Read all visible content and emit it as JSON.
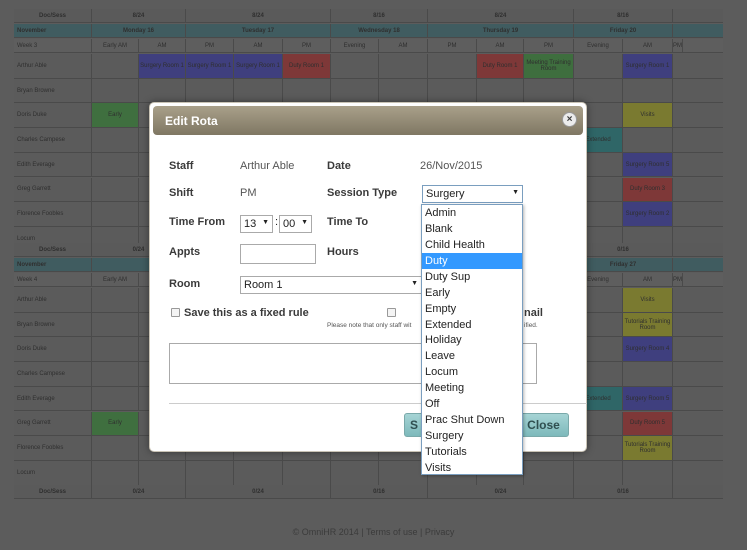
{
  "grid": {
    "doc_label": "Doc/Sess",
    "doc_counts": [
      "8/24",
      "8/24",
      "8/16",
      "8/24",
      "8/16"
    ],
    "bottom_doc_counts": [
      "0/24",
      "0/24",
      "0/16",
      "0/24",
      "0/16"
    ],
    "block1": {
      "month": "November",
      "days": [
        "Monday 16",
        "Tuesday 17",
        "Wednesday 18",
        "Thursday 19",
        "Friday 20"
      ],
      "week": "Week 3",
      "sessions": [
        "Early AM",
        "AM",
        "PM",
        "AM",
        "PM",
        "Evening",
        "AM",
        "PM",
        "AM",
        "PM",
        "Evening",
        "AM",
        "PM"
      ],
      "staff": [
        "Arthur Able",
        "Bryan Browne",
        "Doris Duke",
        "Charles Campese",
        "Edith Everage",
        "Greg Garrett",
        "Florence Foobles",
        "Locum"
      ]
    },
    "block2": {
      "month": "November",
      "last_day": "Friday 27",
      "week": "Week 4",
      "sessions": [
        "Early AM",
        "AM",
        "PM",
        "AM",
        "PM",
        "Evening",
        "AM",
        "PM",
        "AM",
        "PM",
        "Evening",
        "AM",
        "PM"
      ],
      "staff": [
        "Arthur Able",
        "Bryan Browne",
        "Doris Duke",
        "Charles Campese",
        "Edith Everage",
        "Greg Garrett",
        "Florence Foobles",
        "Locum"
      ]
    },
    "cells": {
      "surgery_room1": "Surgery Room 1",
      "duty_room1": "Duty Room 1",
      "meeting_training": "Meeting Training Room",
      "early": "Early",
      "visits": "Visits",
      "duty_room4": "Duty Room 4",
      "surgery_room5": "Surgery Room 5",
      "duty_room3": "Duty Room 3",
      "surgery_room3": "Surgery Room 3",
      "surgery_room2": "Surgery Room 2",
      "tutorials_training": "Tutorials Training Room",
      "surgery_room4": "Surgery Room 4",
      "extended": "Extended",
      "duty_room5": "Duty Room 5"
    }
  },
  "footer": {
    "copyright": "© OmniHR 2014",
    "sep": "|",
    "terms": "Terms of use",
    "privacy": "Privacy"
  },
  "modal": {
    "title": "Edit Rota",
    "close_icon": "×",
    "staff_label": "Staff",
    "staff_value": "Arthur Able",
    "date_label": "Date",
    "date_value": "26/Nov/2015",
    "shift_label": "Shift",
    "shift_value": "PM",
    "session_type_label": "Session Type",
    "session_type_value": "Surgery",
    "time_from_label": "Time From",
    "time_from_hour": "13",
    "time_from_min": "00",
    "time_sep": ":",
    "time_to_label": "Time To",
    "appts_label": "Appts",
    "hours_label": "Hours",
    "room_label": "Room",
    "room_value": "Room 1",
    "fixed_rule_label": "Save this as a fixed rule",
    "email_label_partial": "nail",
    "note_text": "Please note that only staff wit",
    "note_text_tail": "ified.",
    "save_button_partial": "S",
    "close_button": "Close"
  },
  "dropdown": {
    "options": [
      "Admin",
      "Blank",
      "Child Health",
      "Duty",
      "Duty Sup",
      "Early",
      "Empty",
      "Extended",
      "Holiday",
      "Leave",
      "Locum",
      "Meeting",
      "Off",
      "Prac Shut Down",
      "Surgery",
      "Tutorials",
      "Visits"
    ],
    "highlighted": "Duty"
  },
  "colors": {
    "surgery": "#3f3f7e",
    "duty": "#7e3838",
    "meeting": "#3e6e3e",
    "visits": "#7a7a30",
    "early": "#3f6f3f",
    "extended": "#2f6667",
    "header_teal": "#405c60",
    "button_teal": "#8cc4c6",
    "option_highlight": "#3399ff"
  }
}
